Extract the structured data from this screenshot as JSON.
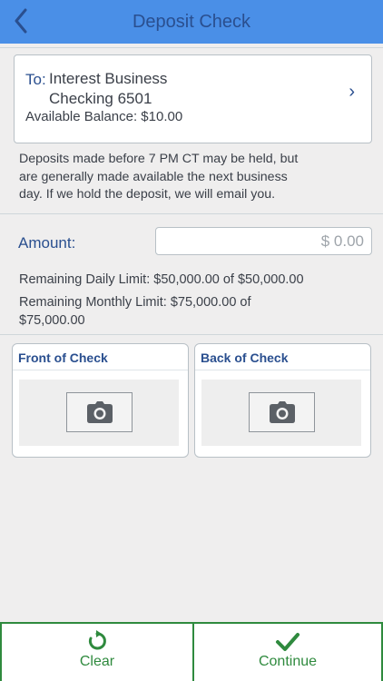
{
  "header": {
    "title": "Deposit Check",
    "back_icon": "chevron-left-icon"
  },
  "to_account": {
    "to_label": "To:",
    "account_line1": "Interest Business",
    "account_line2": "Checking 6501",
    "available_balance": "Available Balance: $10.00",
    "chevron": "›"
  },
  "notice": "Deposits made before 7 PM CT may be held, but are generally made available the next business day. If we hold the deposit, we will email you.",
  "amount": {
    "label": "Amount:",
    "placeholder": "$ 0.00",
    "value": ""
  },
  "limits": {
    "daily": "Remaining Daily Limit: $50,000.00 of $50,000.00",
    "monthly": "Remaining Monthly Limit: $75,000.00 of $75,000.00"
  },
  "checks": {
    "front_label": "Front of Check",
    "back_label": "Back of Check",
    "camera_icon": "camera-icon"
  },
  "bottom_bar": {
    "clear_label": "Clear",
    "continue_label": "Continue",
    "accent_color": "#2f8a3e"
  },
  "colors": {
    "header_bg": "#4a8fe7",
    "title_text": "#2a4f8f",
    "page_bg": "#efeeee"
  }
}
